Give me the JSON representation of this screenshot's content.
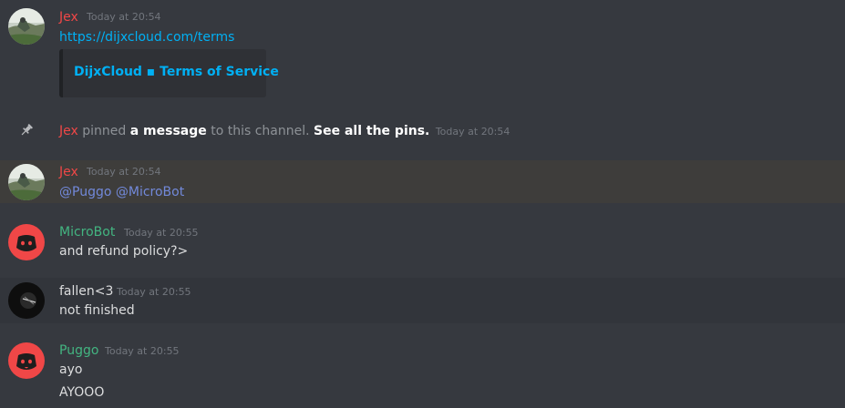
{
  "messages": {
    "m1": {
      "author": "Jex",
      "author_color": "#f04747",
      "timestamp": "Today at 20:54",
      "link": "https://dijxcloud.com/terms",
      "embed_title": "DijxCloud ▪ Terms of Service"
    },
    "pin": {
      "author": "Jex",
      "pre": "pinned",
      "msg_link": "a message",
      "mid": "to this channel.",
      "see_pins": "See all the pins.",
      "timestamp": "Today at 20:54"
    },
    "m2": {
      "author": "Jex",
      "timestamp": "Today at 20:54",
      "mention1": "@Puggo",
      "mention2": "@MicroBot"
    },
    "m3": {
      "author": "MicroBot",
      "author_color": "#43b581",
      "timestamp": "Today at 20:55",
      "text": "and refund policy?>"
    },
    "m4": {
      "author": "fallen<3",
      "author_color": "#dcddde",
      "timestamp": "Today at 20:55",
      "text": "not finished"
    },
    "m5": {
      "author": "Puggo",
      "author_color": "#43b581",
      "timestamp": "Today at 20:55",
      "line1": "ayo",
      "line2": "AYOOO"
    }
  },
  "colors": {
    "background": "#36393f",
    "highlight_row": "#3e3d3b",
    "hover_row": "#32353b",
    "link": "#00b0f4",
    "mention": "#7289da"
  },
  "icons": {
    "pin": "pin-icon",
    "discord_default_avatar": "discord-logo-icon"
  }
}
